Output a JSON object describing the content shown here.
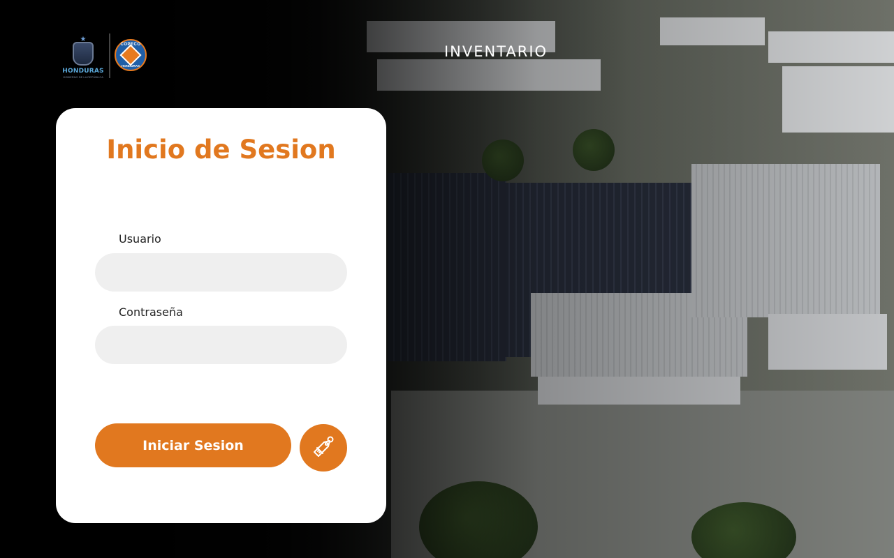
{
  "header": {
    "title": "INVENTARIO",
    "logo_left_text": "HONDURAS",
    "logo_left_subtext": "GOBIERNO DE LA REPÚBLICA",
    "logo_right_text_top": "COPECO",
    "logo_right_text_bottom": "HONDURAS"
  },
  "login": {
    "title": "Inicio de Sesion",
    "username_label": "Usuario",
    "username_value": "",
    "password_label": "Contraseña",
    "password_value": "",
    "submit_label": "Iniciar Sesion",
    "icon_button": "key-tag-icon"
  },
  "colors": {
    "accent": "#e1781f",
    "card_bg": "#ffffff",
    "input_bg": "#efefef",
    "page_bg": "#000000"
  }
}
